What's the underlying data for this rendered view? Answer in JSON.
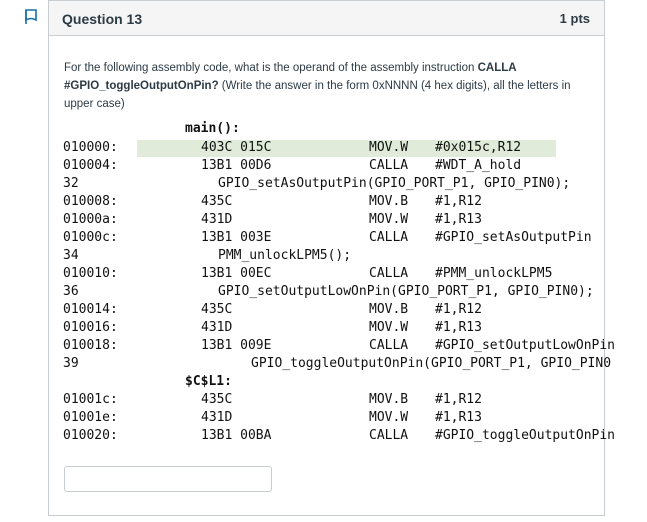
{
  "question": {
    "title": "Question 13",
    "points": "1 pts",
    "text_pre": "For the following assembly code, what is the operand of the assembly instruction ",
    "text_bold": "CALLA #GPIO_toggleOutputOnPin?",
    "text_post": " (Write the answer in the form 0xNNNN (4 hex digits), all the letters in upper case)"
  },
  "code": {
    "label_main": "main():",
    "label_ccl1": "$C$L1:",
    "rows": [
      {
        "addr": "010000:",
        "op": "403C 015C",
        "mn": "MOV.W",
        "arg": "#0x015c,R12"
      },
      {
        "addr": "010004:",
        "op": "13B1 00D6",
        "mn": "CALLA",
        "arg": "#WDT_A_hold"
      },
      {
        "addr": "32",
        "src": "GPIO_setAsOutputPin(GPIO_PORT_P1, GPIO_PIN0);"
      },
      {
        "addr": "010008:",
        "op": "435C",
        "mn": "MOV.B",
        "arg": "#1,R12"
      },
      {
        "addr": "01000a:",
        "op": "431D",
        "mn": "MOV.W",
        "arg": "#1,R13"
      },
      {
        "addr": "01000c:",
        "op": "13B1 003E",
        "mn": "CALLA",
        "arg": "#GPIO_setAsOutputPin"
      },
      {
        "addr": "34",
        "src": "PMM_unlockLPM5();"
      },
      {
        "addr": "010010:",
        "op": "13B1 00EC",
        "mn": "CALLA",
        "arg": "#PMM_unlockLPM5"
      },
      {
        "addr": "36",
        "src": "GPIO_setOutputLowOnPin(GPIO_PORT_P1, GPIO_PIN0);"
      },
      {
        "addr": "010014:",
        "op": "435C",
        "mn": "MOV.B",
        "arg": "#1,R12"
      },
      {
        "addr": "010016:",
        "op": "431D",
        "mn": "MOV.W",
        "arg": "#1,R13"
      },
      {
        "addr": "010018:",
        "op": "13B1 009E",
        "mn": "CALLA",
        "arg": "#GPIO_setOutputLowOnPin"
      },
      {
        "addr": "39",
        "src": "GPIO_toggleOutputOnPin(GPIO_PORT_P1, GPIO_PIN0"
      },
      {
        "addr": "01001c:",
        "op": "435C",
        "mn": "MOV.B",
        "arg": "#1,R12"
      },
      {
        "addr": "01001e:",
        "op": "431D",
        "mn": "MOV.W",
        "arg": "#1,R13"
      },
      {
        "addr": "010020:",
        "op": "13B1 00BA",
        "mn": "CALLA",
        "arg": "#GPIO_toggleOutputOnPin"
      }
    ]
  },
  "answer": {
    "value": "",
    "placeholder": ""
  },
  "colors": {
    "highlight": "#e0ecd9",
    "flag": "#1770ab",
    "border": "#c7cdd1"
  }
}
